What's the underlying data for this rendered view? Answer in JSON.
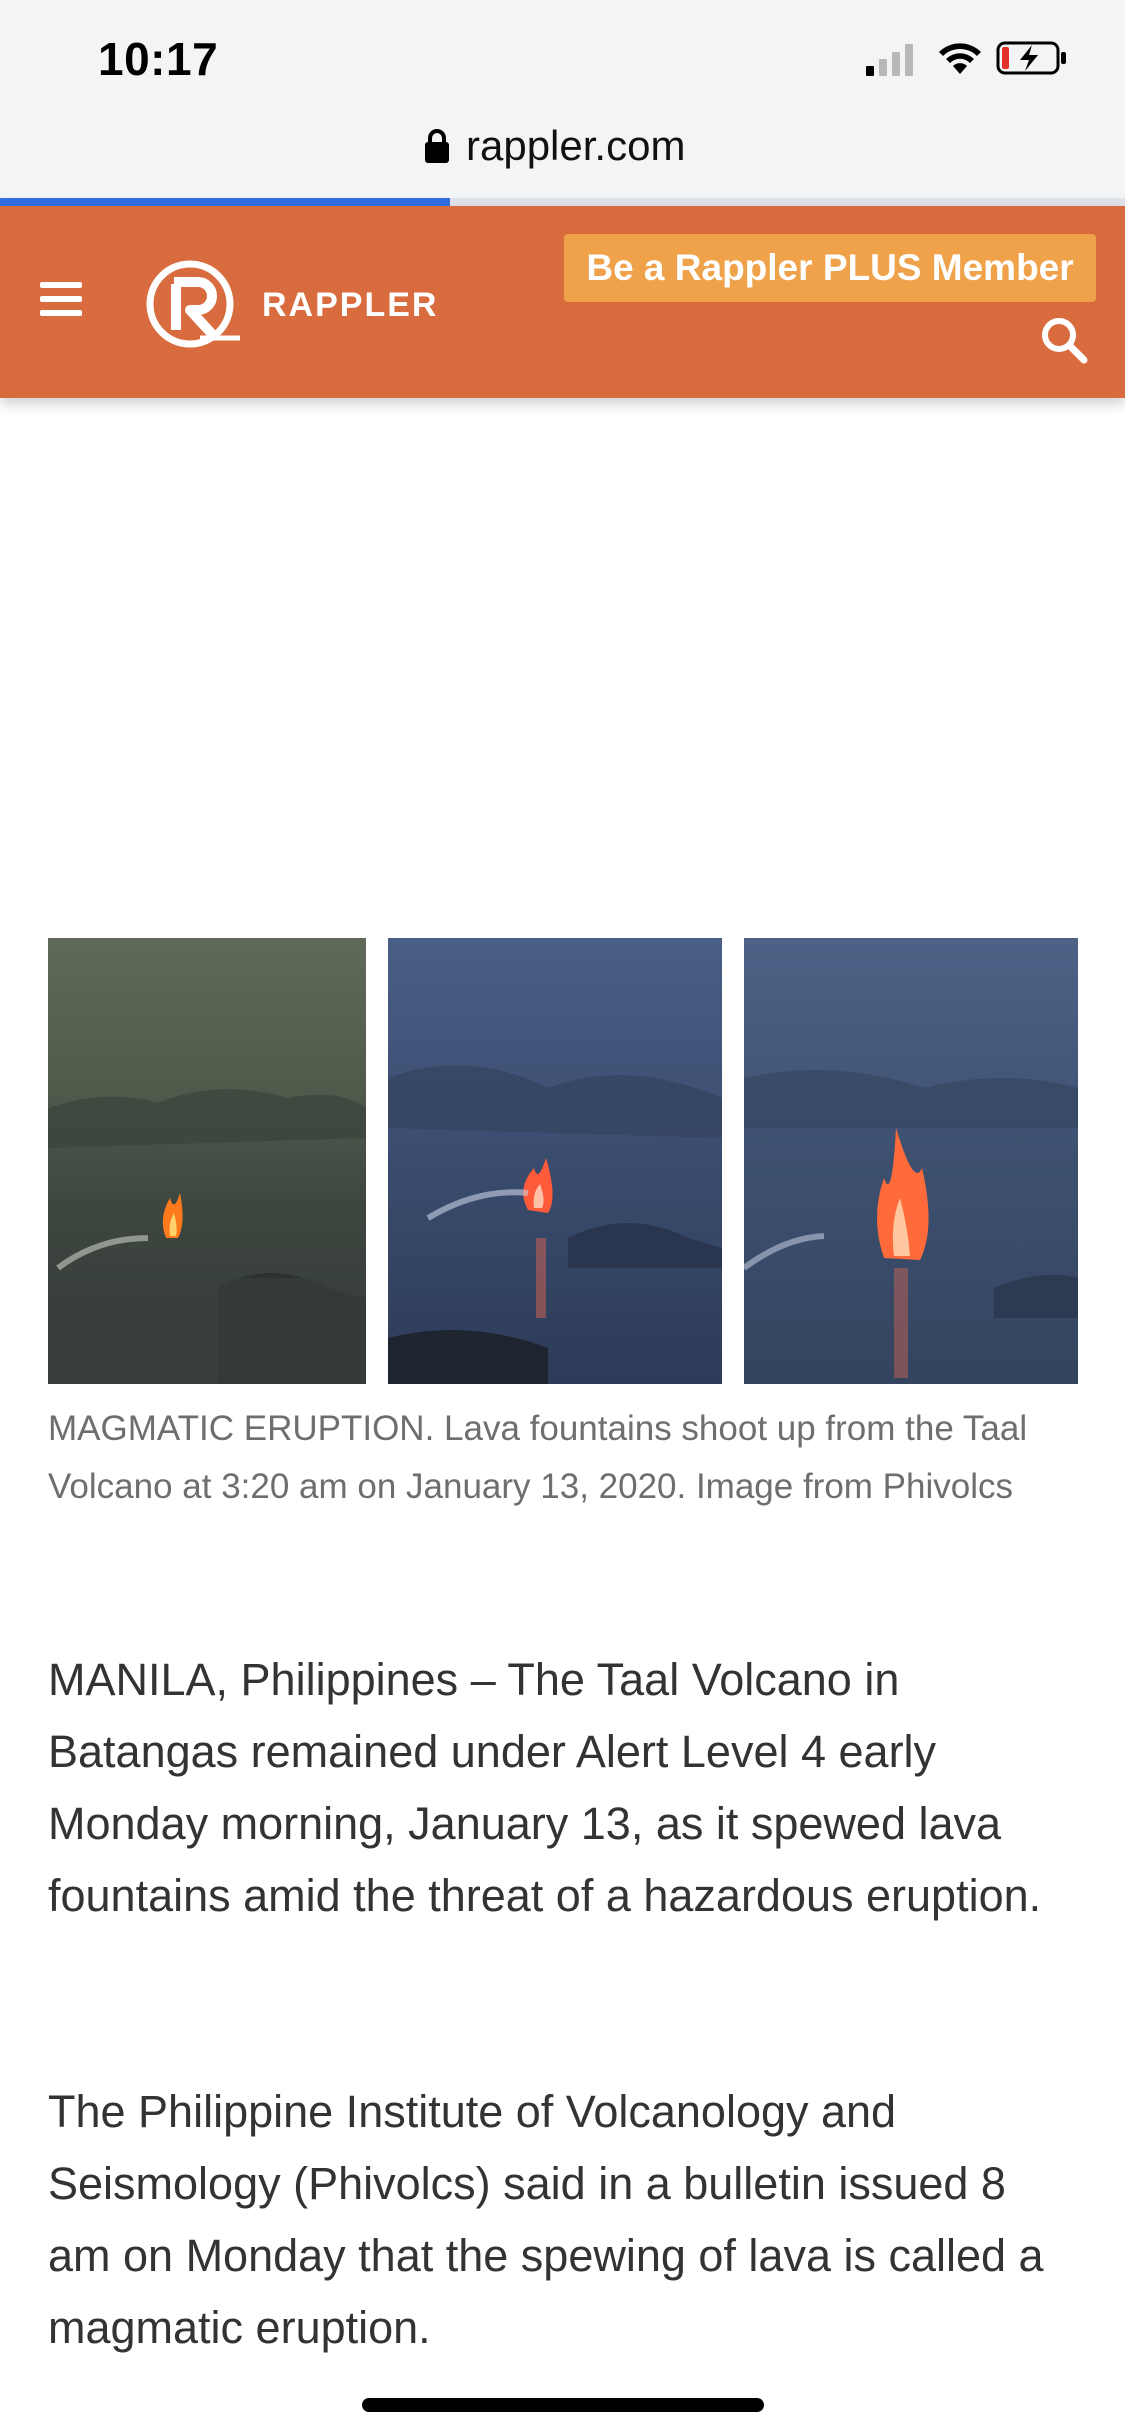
{
  "status_bar": {
    "time": "10:17",
    "icons": [
      "cellular-signal-icon",
      "wifi-icon",
      "battery-charging-icon"
    ]
  },
  "browser": {
    "url": "rappler.com",
    "load_progress": 0.4
  },
  "header": {
    "logo_text": "RAPPLER",
    "plus_button_label": "Be a Rappler PLUS Member",
    "icons": [
      "menu-icon",
      "rappler-logo-icon",
      "search-icon"
    ],
    "brand_color": "#d96c3e",
    "accent_color": "#f0a24a"
  },
  "article": {
    "caption": "MAGMATIC ERUPTION. Lava fountains shoot up from the Taal Volcano at 3:20 am on January 13, 2020. Image from Phivolcs",
    "paragraphs": [
      "MANILA, Philippines – The Taal Volcano in Batangas remained under Alert Level 4 early Monday morning, January 13, as it spewed lava fountains amid the threat of a hazardous eruption.",
      "The Philippine Institute of Volcanology and Seismology (Phivolcs) said in a bulletin issued 8 am on Monday that the spewing of lava is called a magmatic eruption."
    ]
  }
}
